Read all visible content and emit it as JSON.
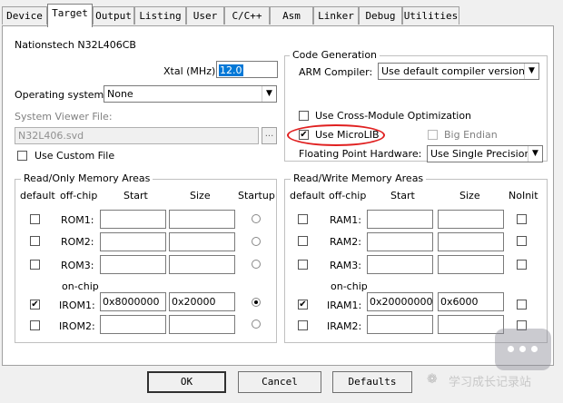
{
  "tabs": [
    "Device",
    "Target",
    "Output",
    "Listing",
    "User",
    "C/C++",
    "Asm",
    "Linker",
    "Debug",
    "Utilities"
  ],
  "active_tab": "Target",
  "device_name": "Nationstech N32L406CB",
  "xtal": {
    "label": "Xtal (MHz):",
    "value": "12.0"
  },
  "os": {
    "label": "Operating system:",
    "value": "None"
  },
  "svd": {
    "label": "System Viewer File:",
    "value": "N32L406.svd",
    "browse": "..."
  },
  "custom_file": {
    "label": "Use Custom File",
    "checked": false
  },
  "codegen": {
    "title": "Code Generation",
    "compiler_label": "ARM Compiler:",
    "compiler_value": "Use default compiler version",
    "cross_module": {
      "label": "Use Cross-Module Optimization",
      "checked": false
    },
    "microlib": {
      "label": "Use MicroLIB",
      "checked": true
    },
    "big_endian": {
      "label": "Big Endian",
      "checked": false
    },
    "fp_label": "Floating Point Hardware:",
    "fp_value": "Use Single Precision"
  },
  "ro": {
    "title": "Read/Only Memory Areas",
    "headers": {
      "default": "default",
      "offchip": "off-chip",
      "start": "Start",
      "size": "Size",
      "mode": "Startup"
    },
    "onchip_label": "on-chip",
    "rows": [
      {
        "name": "ROM1:",
        "start": "",
        "size": "",
        "checked": false,
        "selected": false
      },
      {
        "name": "ROM2:",
        "start": "",
        "size": "",
        "checked": false,
        "selected": false
      },
      {
        "name": "ROM3:",
        "start": "",
        "size": "",
        "checked": false,
        "selected": false
      },
      {
        "name": "IROM1:",
        "start": "0x8000000",
        "size": "0x20000",
        "checked": true,
        "selected": true
      },
      {
        "name": "IROM2:",
        "start": "",
        "size": "",
        "checked": false,
        "selected": false
      }
    ]
  },
  "rw": {
    "title": "Read/Write Memory Areas",
    "headers": {
      "default": "default",
      "offchip": "off-chip",
      "start": "Start",
      "size": "Size",
      "mode": "NoInit"
    },
    "onchip_label": "on-chip",
    "rows": [
      {
        "name": "RAM1:",
        "start": "",
        "size": "",
        "checked": false,
        "noinit": false
      },
      {
        "name": "RAM2:",
        "start": "",
        "size": "",
        "checked": false,
        "noinit": false
      },
      {
        "name": "RAM3:",
        "start": "",
        "size": "",
        "checked": false,
        "noinit": false
      },
      {
        "name": "IRAM1:",
        "start": "0x20000000",
        "size": "0x6000",
        "checked": true,
        "noinit": false
      },
      {
        "name": "IRAM2:",
        "start": "",
        "size": "",
        "checked": false,
        "noinit": false
      }
    ]
  },
  "buttons": {
    "ok": "OK",
    "cancel": "Cancel",
    "defaults": "Defaults"
  },
  "watermark": "学习成长记录站",
  "colors": {
    "highlight": "#e02020",
    "selection": "#0078d7"
  }
}
